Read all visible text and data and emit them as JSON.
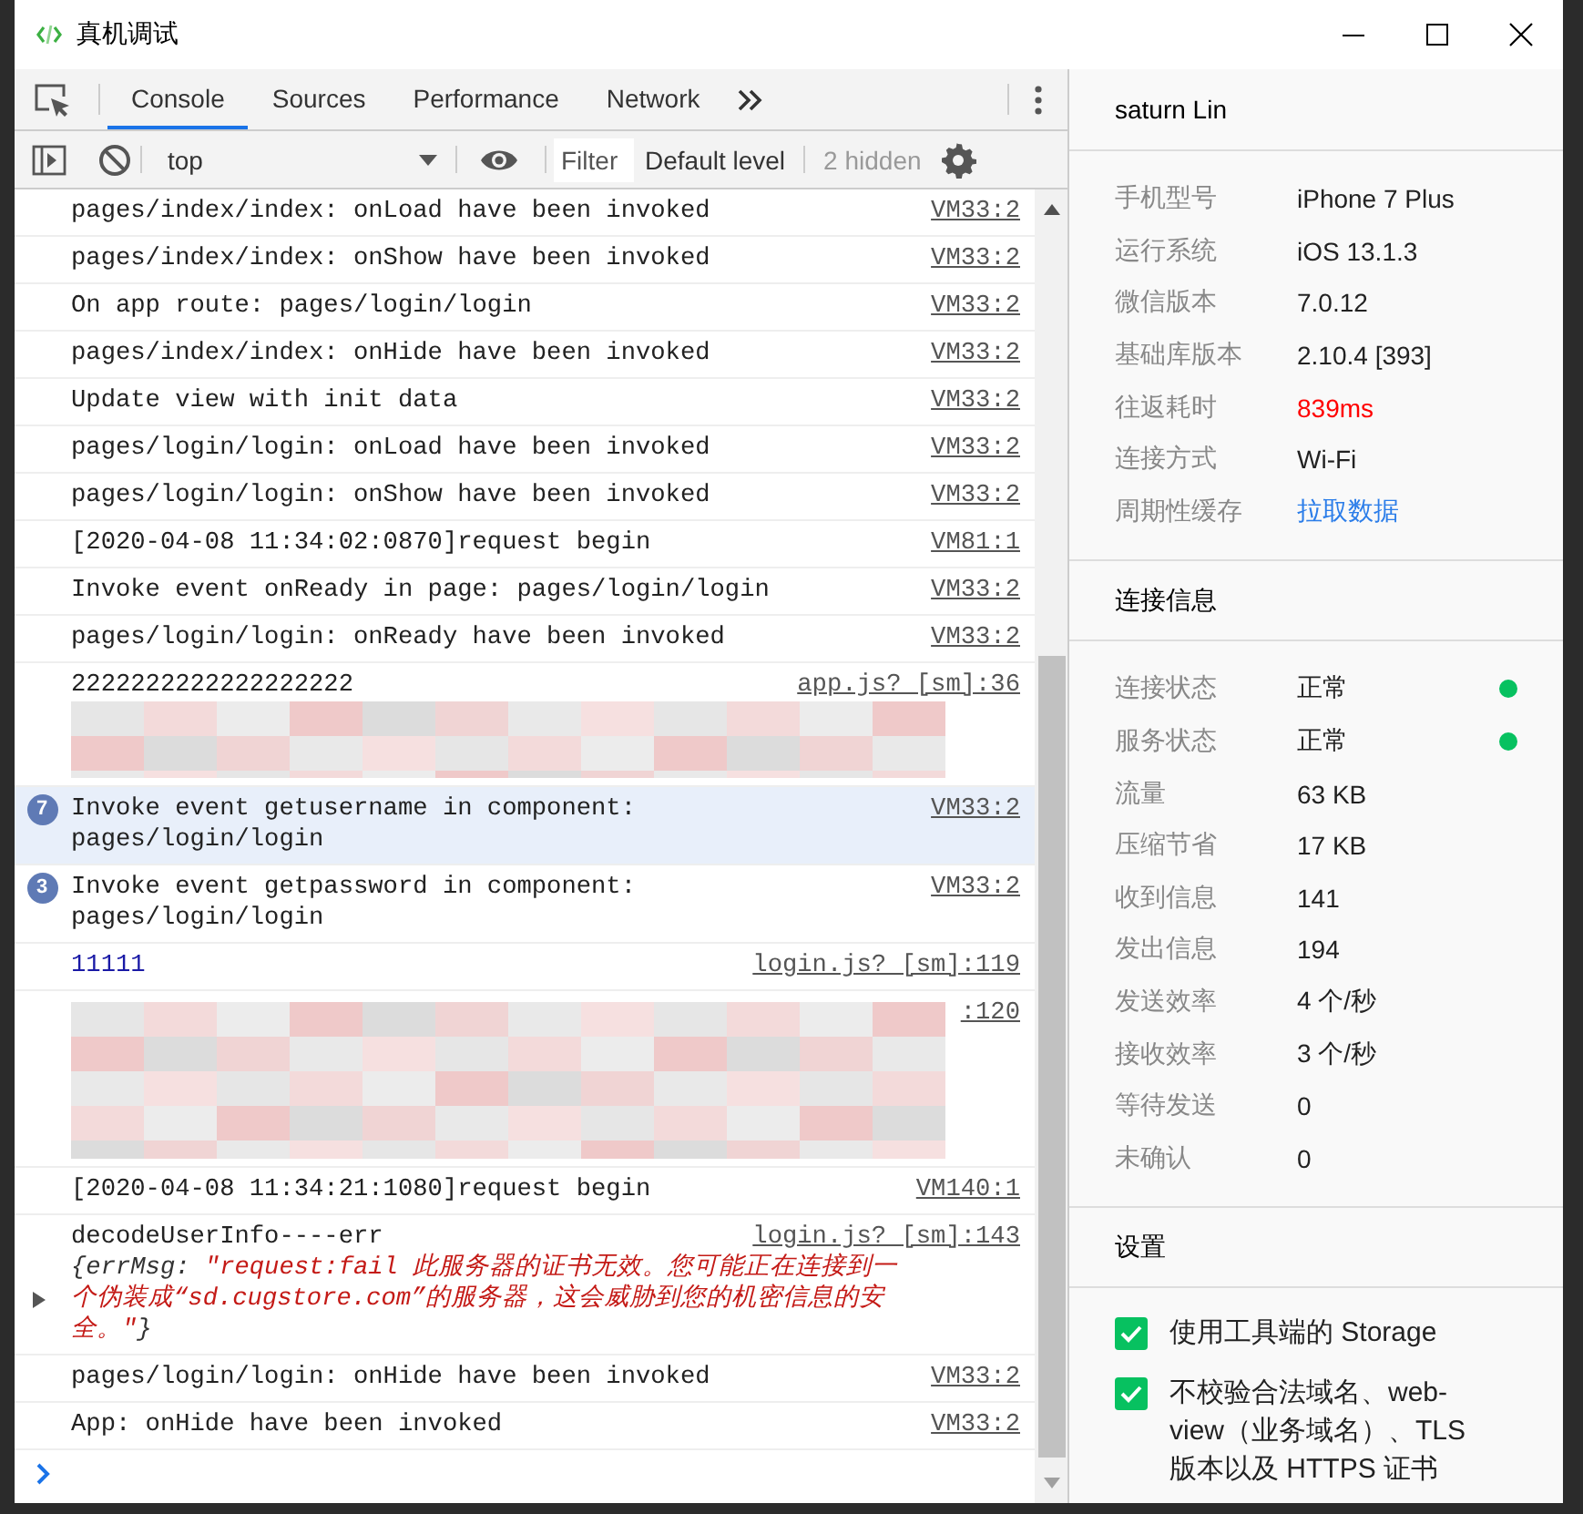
{
  "window": {
    "title": "真机调试"
  },
  "devtools": {
    "tabs": [
      {
        "label": "Console",
        "selected": true
      },
      {
        "label": "Sources",
        "selected": false
      },
      {
        "label": "Performance",
        "selected": false
      },
      {
        "label": "Network",
        "selected": false
      }
    ],
    "toolbar": {
      "context": "top",
      "filter": {
        "placeholder": "Filter"
      },
      "level": "Default level",
      "hidden": "2 hidden"
    },
    "messages": [
      {
        "kind": "log",
        "text": "pages/index/index: onLoad have been invoked",
        "source": "VM33:2"
      },
      {
        "kind": "log",
        "text": "pages/index/index: onShow have been invoked",
        "source": "VM33:2"
      },
      {
        "kind": "log",
        "text": "On app route: pages/login/login",
        "source": "VM33:2"
      },
      {
        "kind": "log",
        "text": "pages/index/index: onHide have been invoked",
        "source": "VM33:2"
      },
      {
        "kind": "log",
        "text": "Update view with init data",
        "source": "VM33:2"
      },
      {
        "kind": "log",
        "text": "pages/login/login: onLoad have been invoked",
        "source": "VM33:2"
      },
      {
        "kind": "log",
        "text": "pages/login/login: onShow have been invoked",
        "source": "VM33:2"
      },
      {
        "kind": "log",
        "text": "[2020-04-08 11:34:02:0870]request begin",
        "source": "VM81:1"
      },
      {
        "kind": "log",
        "text": "Invoke event onReady in page: pages/login/login",
        "source": "VM33:2"
      },
      {
        "kind": "log",
        "text": "pages/login/login: onReady have been invoked",
        "source": "VM33:2"
      },
      {
        "kind": "log",
        "text": "2222222222222222222",
        "source": "app.js? [sm]:36",
        "redacted": true
      },
      {
        "kind": "log",
        "text": "Invoke event getusername in component: pages/login/login",
        "source": "VM33:2",
        "count": "7",
        "selected": true
      },
      {
        "kind": "log",
        "text": "Invoke event getpassword in component: pages/login/login",
        "source": "VM33:2",
        "count": "3",
        "selected": false
      },
      {
        "kind": "number",
        "text": "11111",
        "source": "login.js? [sm]:119"
      },
      {
        "kind": "blank",
        "source": ":120",
        "redacted": true
      },
      {
        "kind": "log",
        "text": "[2020-04-08 11:34:21:1080]request begin",
        "source": "VM140:1"
      },
      {
        "kind": "object",
        "text": "decodeUserInfo----err",
        "source": "login.js? [sm]:143",
        "detail": {
          "prefix": "{errMsg: ",
          "value": "\"request:fail 此服务器的证书无效。您可能正在连接到一个伪装成“sd.cugstore.com”的服务器，这会威胁到您的机密信息的安全。\"",
          "suffix": "}",
          "expanded": false
        }
      },
      {
        "kind": "log",
        "text": "pages/login/login: onHide have been invoked",
        "source": "VM33:2"
      },
      {
        "kind": "log",
        "text": "App: onHide have been invoked",
        "source": "VM33:2"
      }
    ]
  },
  "device_panel": {
    "user": "saturn Lin",
    "info": [
      {
        "label": "手机型号",
        "value": "iPhone 7 Plus",
        "kind": "text"
      },
      {
        "label": "运行系统",
        "value": "iOS 13.1.3",
        "kind": "text"
      },
      {
        "label": "微信版本",
        "value": "7.0.12",
        "kind": "text"
      },
      {
        "label": "基础库版本",
        "value": "2.10.4 [393]",
        "kind": "text"
      },
      {
        "label": "往返耗时",
        "value": "839ms",
        "kind": "warning"
      },
      {
        "label": "连接方式",
        "value": "Wi-Fi",
        "kind": "text"
      },
      {
        "label": "周期性缓存",
        "value": "拉取数据",
        "kind": "link"
      }
    ],
    "connection_title": "连接信息",
    "connection": [
      {
        "label": "连接状态",
        "value": "正常",
        "color": "#07c160"
      },
      {
        "label": "服务状态",
        "value": "正常",
        "color": "#07c160"
      },
      {
        "label": "流量",
        "value": "63 KB"
      },
      {
        "label": "压缩节省",
        "value": "17 KB"
      },
      {
        "label": "收到信息",
        "value": "141"
      },
      {
        "label": "发出信息",
        "value": "194"
      },
      {
        "label": "发送效率",
        "value": "4 个/秒"
      },
      {
        "label": "接收效率",
        "value": "3 个/秒"
      },
      {
        "label": "等待发送",
        "value": "0"
      },
      {
        "label": "未确认",
        "value": "0"
      }
    ],
    "settings_title": "设置",
    "settings": [
      {
        "label": "使用工具端的 Storage",
        "checked": true
      },
      {
        "label": "不校验合法域名、web-view（业务域名）、TLS 版本以及 HTTPS 证书",
        "checked": true
      }
    ]
  }
}
